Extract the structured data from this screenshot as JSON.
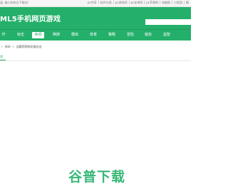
{
  "topbar": {
    "welcome": "迎, 放心的安全下载站!",
    "links": [
      "pc传奇",
      "软件分类",
      "pc游戏网",
      "pc安卓网",
      "pc苹果网",
      "电脑版",
      "小程游",
      "精"
    ]
  },
  "header": {
    "logo": "ML5手机网页游戏",
    "search_placeholder": ""
  },
  "nav": {
    "items": [
      {
        "label": "作",
        "active": false
      },
      {
        "label": "射击",
        "active": false
      },
      {
        "label": "休闲",
        "active": true
      },
      {
        "label": "棋牌",
        "active": false
      },
      {
        "label": "模拟",
        "active": false
      },
      {
        "label": "体育",
        "active": false
      },
      {
        "label": "策略",
        "active": false
      },
      {
        "label": "冒险",
        "active": false
      },
      {
        "label": "装扮",
        "active": false
      },
      {
        "label": "益智",
        "active": false
      }
    ]
  },
  "breadcrumb": {
    "items": [
      "休闲",
      "去戳洞洞抢彩蛋抗出"
    ],
    "separator": ">"
  },
  "section": {
    "title": "戏"
  },
  "watermark": {
    "text": "谷普下载",
    "color": "#24b06a"
  },
  "colors": {
    "brand": "#24b06a"
  }
}
